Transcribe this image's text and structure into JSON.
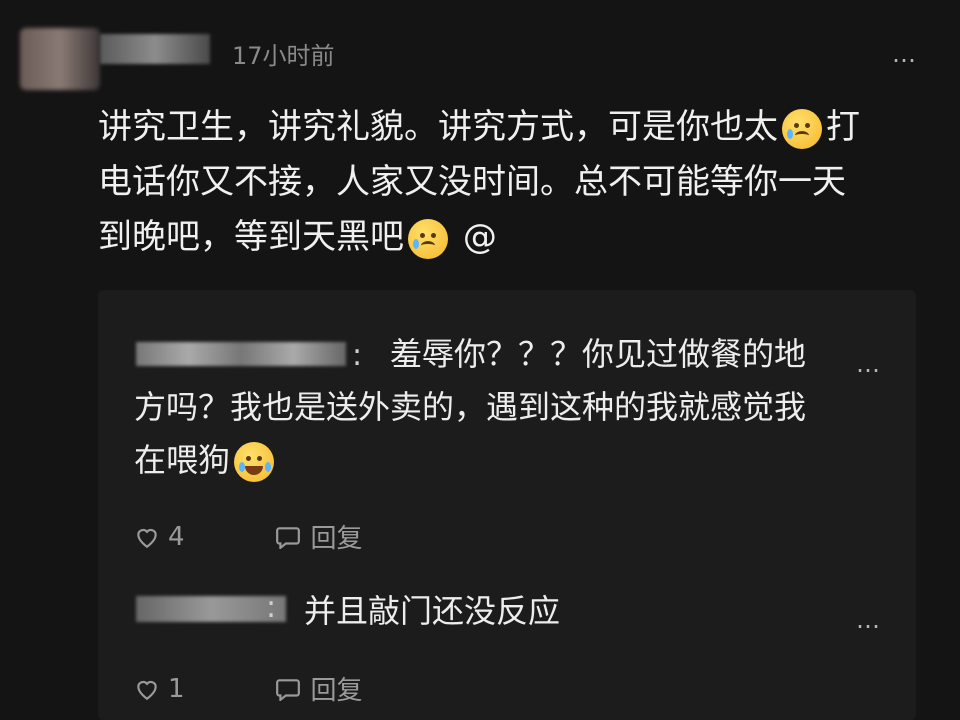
{
  "comment": {
    "time": "17小时前",
    "more_label": "…",
    "line1_a": "讲究卫生，讲究礼貌。讲究方式，可是你也太",
    "line1_b": "打",
    "line2": "电话你又不接，人家又没时间。总不可能等你一天",
    "line3_a": "到晚吧，等到天黑吧",
    "line3_b": "@",
    "emoji_1": "crying-face",
    "emoji_2": "crying-face"
  },
  "replies": [
    {
      "text": "羞辱你？？？你见过做餐的地方吗？我也是送外卖的，遇到这种的我就感觉我在喂狗",
      "emoji": "tears-of-joy",
      "like_count": "4",
      "reply_label": "回复",
      "more_label": "…"
    },
    {
      "text": "并且敲门还没反应",
      "like_count": "1",
      "reply_label": "回复",
      "more_label": "…"
    }
  ]
}
